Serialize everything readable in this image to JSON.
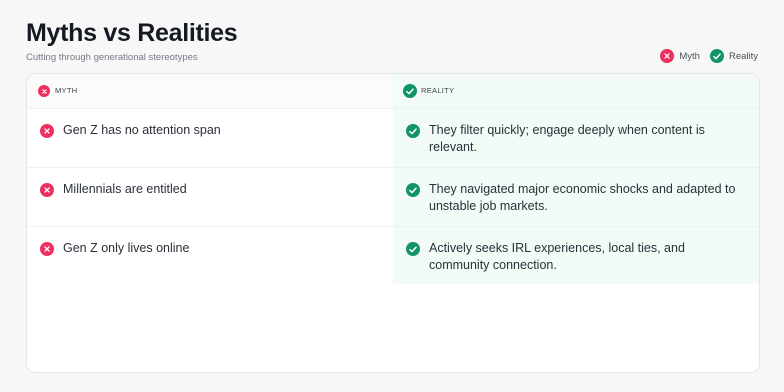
{
  "header": {
    "title": "Myths vs Realities",
    "subtitle": "Cutting through generational stereotypes"
  },
  "legend": {
    "myth_label": "Myth",
    "reality_label": "Reality"
  },
  "table": {
    "columns": {
      "myth": "MYTH",
      "reality": "REALITY"
    },
    "rows": [
      {
        "myth": "Gen Z has no attention span",
        "reality": "They filter quickly; engage deeply when content is relevant."
      },
      {
        "myth": "Millennials are entitled",
        "reality": "They navigated major economic shocks and adapted to unstable job markets."
      },
      {
        "myth": "Gen Z only lives online",
        "reality": "Actively seeks IRL experiences, local ties, and community connection."
      }
    ]
  },
  "colors": {
    "myth": "#ee2f5f",
    "reality": "#119466",
    "reality_bg": "#f3fbf7"
  },
  "icons": {
    "myth": "x-circle-icon",
    "reality": "check-circle-icon"
  }
}
